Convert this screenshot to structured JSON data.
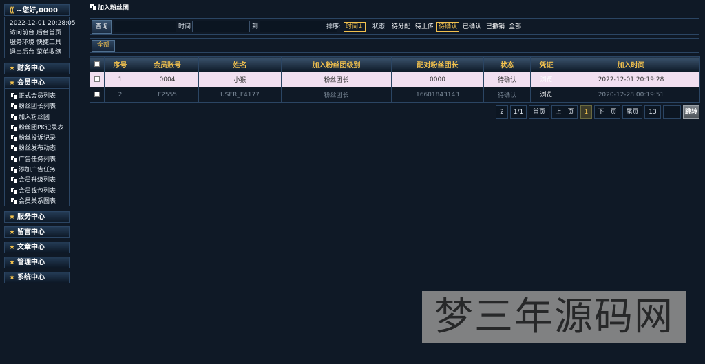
{
  "sidebar": {
    "greeting": "~您好,0000",
    "datetime": "2022-12-01 20:28:05",
    "quick_links": [
      [
        "访问前台",
        "后台首页"
      ],
      [
        "服务环境",
        "快捷工具"
      ],
      [
        "退出后台",
        "菜单收缩"
      ]
    ],
    "sections": {
      "finance": "财务中心",
      "member": "会员中心",
      "service": "服务中心",
      "message": "留言中心",
      "article": "文章中心",
      "manage": "管理中心",
      "system": "系统中心"
    },
    "member_items": [
      "正式会员列表",
      "粉丝团长列表",
      "加入粉丝团",
      "粉丝团PK记录表",
      "粉丝投诉记录",
      "粉丝发布动态",
      "广告任务列表",
      "添加广告任务",
      "会员升级列表",
      "会员钱包列表",
      "会员关系图表"
    ]
  },
  "page": {
    "title": "加入粉丝团"
  },
  "search": {
    "query_button": "查询",
    "time_label": "时间",
    "to_label": "到",
    "sort_label": "排序:",
    "sort_value": "时间↓",
    "status_label": "状态:",
    "status_options": [
      "待分配",
      "待上传",
      "待确认",
      "已确认",
      "已撤销",
      "全部"
    ],
    "status_selected": "待确认"
  },
  "filter": {
    "all_label": "全部"
  },
  "table": {
    "headers": [
      "序号",
      "会员账号",
      "姓名",
      "加入粉丝团级别",
      "配对粉丝团长",
      "状态",
      "凭证",
      "加入时间"
    ],
    "rows": [
      {
        "index": "1",
        "account": "0004",
        "name": "小猴",
        "level": "粉丝团长",
        "leader": "0000",
        "status": "待确认",
        "voucher": "浏览",
        "time": "2022-12-01 20:19:28"
      },
      {
        "index": "2",
        "account": "F2555",
        "name": "USER_F4177",
        "level": "粉丝团长",
        "leader": "16601843143",
        "status": "待确认",
        "voucher": "浏览",
        "time": "2020-12-28 00:19:51"
      }
    ]
  },
  "pager": {
    "total": "2",
    "pages": "1/1",
    "first": "首页",
    "prev": "上一页",
    "current": "1",
    "next": "下一页",
    "last": "尾页",
    "page_size": "13",
    "jump": "跳转"
  },
  "watermark": "梦三年源码网",
  "colors": {
    "accent": "#f2c14e",
    "background": "#0f1926",
    "highlight_row": "#f1dff0"
  }
}
